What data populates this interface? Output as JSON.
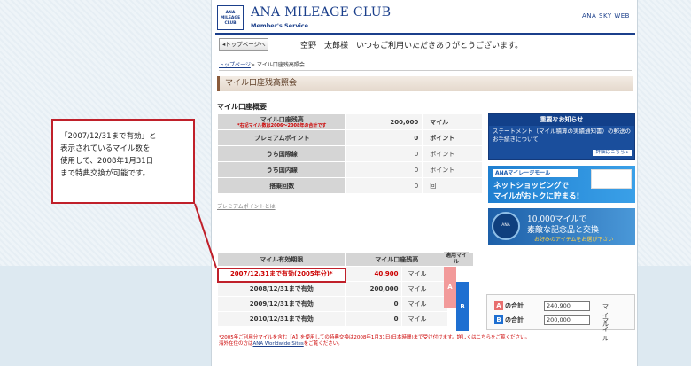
{
  "header": {
    "logo_line1": "ANA",
    "logo_line2": "MILEAGE",
    "logo_line3": "CLUB",
    "brand": "ANA MILEAGE CLUB",
    "brand_sub": "Member's Service",
    "skyweb": "ANA SKY WEB"
  },
  "nav": {
    "top_button": "◂トップページへ",
    "greeting": "空野　太郎様　いつもご利用いただきありがとうございます。",
    "breadcrumb_link": "トップページ",
    "breadcrumb_current": "> マイル口座残高照会"
  },
  "section_title": "マイル口座残高照会",
  "summary": {
    "title": "マイル口座概要",
    "rows": [
      {
        "label": "マイル口座残高",
        "note": "*右記マイル数は2006〜2008年の合計です",
        "value": "200,000",
        "unit": "マイル"
      },
      {
        "label": "プレミアムポイント",
        "note": "",
        "value": "0",
        "unit": "ポイント"
      },
      {
        "label": "うち国際線",
        "note": "",
        "value": "0",
        "unit": "ポイント"
      },
      {
        "label": "うち国内線",
        "note": "",
        "value": "0",
        "unit": "ポイント"
      },
      {
        "label": "搭乗回数",
        "note": "",
        "value": "0",
        "unit": "回"
      }
    ],
    "premium_link": "プレミアムポイントとは"
  },
  "expiry": {
    "headers": [
      "マイル有効期限",
      "マイル口座残高",
      "適用マイル"
    ],
    "rows": [
      {
        "date": "2007/12/31まで有効(2005年分)*",
        "value": "40,900",
        "unit": "マイル"
      },
      {
        "date": "2008/12/31まで有効",
        "value": "200,000",
        "unit": "マイル"
      },
      {
        "date": "2009/12/31まで有効",
        "value": "0",
        "unit": "マイル"
      },
      {
        "date": "2010/12/31まで有効",
        "value": "0",
        "unit": "マイル"
      }
    ],
    "bar_a": "A",
    "bar_b": "B"
  },
  "totals": {
    "a_badge": "A",
    "a_label": "の合計",
    "a_value": "240,900",
    "b_badge": "B",
    "b_label": "の合計",
    "b_value": "200,000",
    "unit": "マイル"
  },
  "footnote": {
    "line1": "*2005年ご利用分マイルを含む【A】を使用しての特典交換は2008年1月31日(日本時間)まで受け付けます。詳しくはこちらをご覧ください。",
    "line2_pre": "海外在住の方は",
    "line2_link": "ANA Worldwide Sites",
    "line2_post": "をご覧ください。"
  },
  "news": {
    "title": "重要なお知らせ",
    "body": "ステートメント（マイル積算の実績通知書）の郵送のお手続きについて",
    "more": "詳細はこちら ▸"
  },
  "banner1": {
    "tag": "ANAマイレージモール",
    "line1": "ネットショッピングで",
    "line2": "マイルがおトクに貯まる!"
  },
  "banner2": {
    "emblem": "ANA Selection",
    "line1": "10,000マイルで",
    "line2": "素敵な記念品と交換",
    "line3": "お好みのアイテムをお選び下さい"
  },
  "callout": {
    "lines": [
      "「2007/12/31まで有効」と",
      "表示されているマイル数を",
      "使用して、2008年1月31日",
      "まで特典交換が可能です。"
    ]
  },
  "colors": {
    "brand_navy": "#1b3f8b",
    "highlight_red": "#c0202a",
    "bar_a": "#f29a9a",
    "bar_b": "#1e6fd1"
  }
}
